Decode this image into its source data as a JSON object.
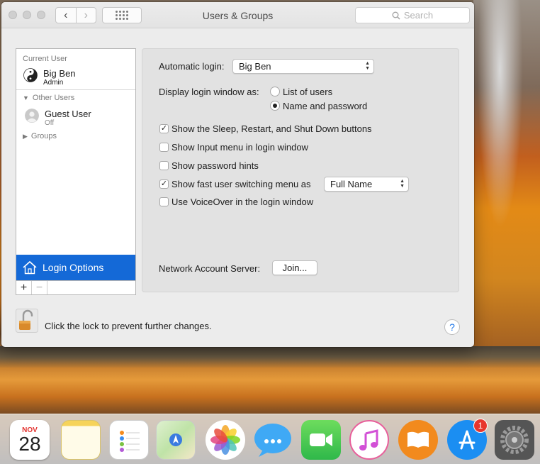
{
  "window": {
    "title": "Users & Groups",
    "search_placeholder": "Search"
  },
  "sidebar": {
    "current_user_label": "Current User",
    "current_user": {
      "name": "Big Ben",
      "role": "Admin"
    },
    "other_users_label": "Other Users",
    "guest": {
      "name": "Guest User",
      "status": "Off"
    },
    "groups_label": "Groups",
    "login_options_label": "Login Options",
    "add_label": "+",
    "remove_label": "−"
  },
  "login": {
    "automatic_login_label": "Automatic login:",
    "automatic_login_value": "Big Ben",
    "display_window_label": "Display login window as:",
    "radio_list": "List of users",
    "radio_name": "Name and password",
    "radio_selected": "Name and password",
    "checkboxes": [
      {
        "label": "Show the Sleep, Restart, and Shut Down buttons",
        "checked": true
      },
      {
        "label": "Show Input menu in login window",
        "checked": false
      },
      {
        "label": "Show password hints",
        "checked": false
      },
      {
        "label": "Show fast user switching menu as",
        "checked": true
      },
      {
        "label": "Use VoiceOver in the login window",
        "checked": false
      }
    ],
    "fast_switch_value": "Full Name",
    "network_server_label": "Network Account Server:",
    "join_label": "Join..."
  },
  "footer": {
    "lock_text": "Click the lock to prevent further changes.",
    "help_label": "?"
  },
  "dock": {
    "calendar_month": "NOV",
    "calendar_day": "28",
    "appstore_badge": "1",
    "icons": [
      "calendar-icon",
      "notes-icon",
      "reminders-icon",
      "maps-icon",
      "photos-icon",
      "messages-icon",
      "facetime-icon",
      "itunes-icon",
      "ibooks-icon",
      "app-store-icon",
      "system-preferences-icon"
    ]
  },
  "colors": {
    "selection": "#1469d7",
    "help_blue": "#1b74e8",
    "window_bg": "#ececec"
  }
}
